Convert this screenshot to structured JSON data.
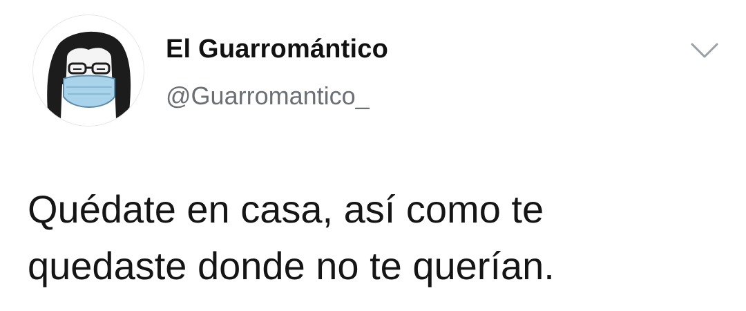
{
  "author": {
    "display_name": "El Guarromántico",
    "handle": "@Guarromantico_",
    "avatar_icon": "masked-person-avatar"
  },
  "menu": {
    "icon": "chevron-down-icon"
  },
  "tweet": {
    "lines": [
      "Quédate en casa, así como te",
      "quedaste donde no te querían."
    ]
  },
  "colors": {
    "mask": "#a9d3ea",
    "handle_text": "#6b6f73",
    "chevron": "#9aa0a6"
  }
}
